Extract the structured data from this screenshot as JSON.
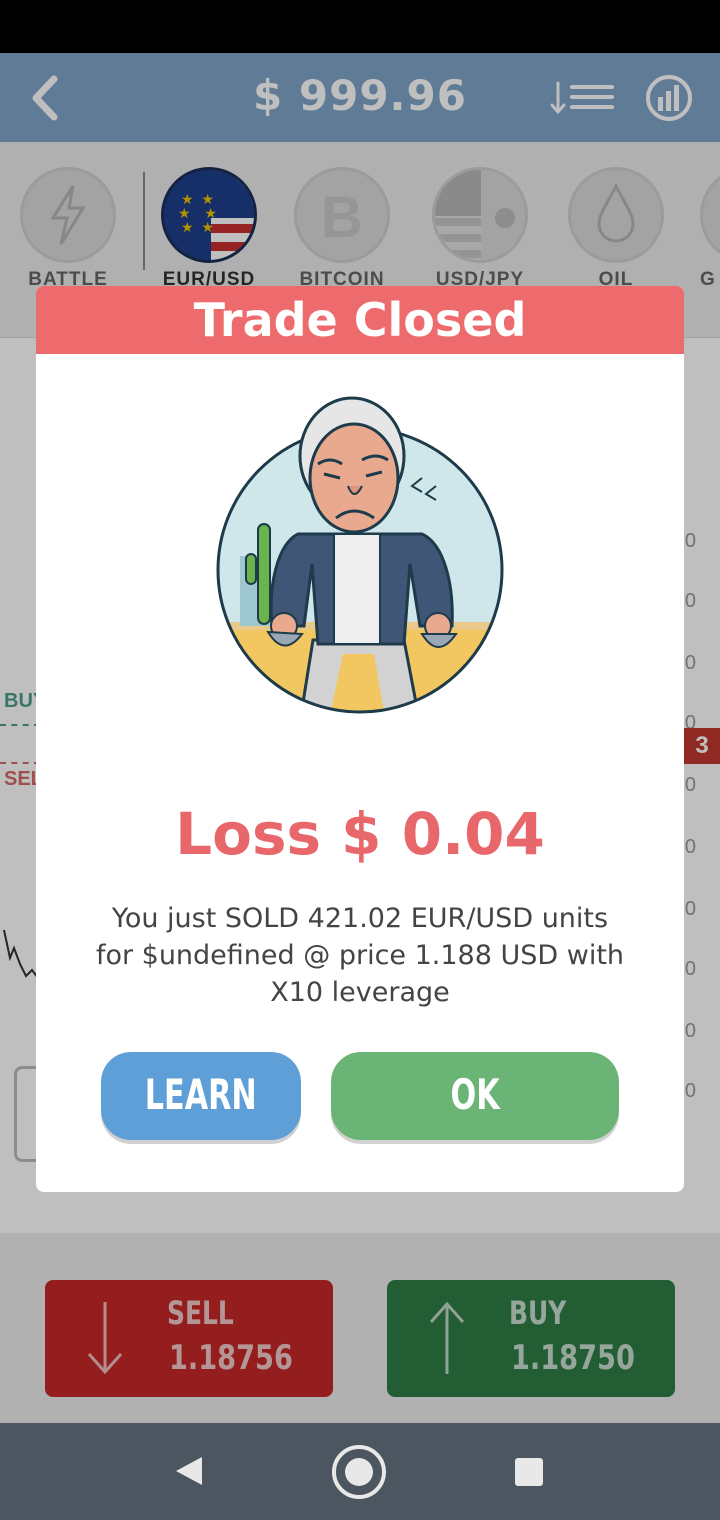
{
  "header": {
    "balance": "$ 999.96"
  },
  "assets": [
    {
      "name": "BATTLE"
    },
    {
      "name": "EUR/USD"
    },
    {
      "name": "BITCOIN"
    },
    {
      "name": "USD/JPY"
    },
    {
      "name": "OIL"
    },
    {
      "name": "G"
    }
  ],
  "chart": {
    "buy_tag": "BUY",
    "sell_tag": "SEL",
    "price_tag": "3",
    "y_ticks": [
      "0",
      "0",
      "0",
      "0",
      "0",
      "0",
      "0",
      "0",
      "0",
      "0"
    ]
  },
  "dialog": {
    "title": "Trade Closed",
    "result": "Loss $ 0.04",
    "message": "You just SOLD 421.02 EUR/USD units for $undefined @ price 1.188 USD with X10 leverage",
    "learn_label": "LEARN",
    "ok_label": "OK"
  },
  "trade": {
    "sell_label": "SELL",
    "sell_price": "1.18756",
    "buy_label": "BUY",
    "buy_price": "1.18750"
  },
  "colors": {
    "header": "#7fa4c9",
    "dialog_header": "#ee6b6d",
    "loss_text": "#e8676a",
    "learn_button": "#5d9fd6",
    "ok_button": "#6ab476",
    "sell_button": "#c62828",
    "buy_button": "#2e7d45"
  },
  "icons": {
    "back": "chevron-left-icon",
    "sort": "sort-list-icon",
    "stats": "stats-chart-icon",
    "nav_back": "triangle-back-icon",
    "nav_home": "circle-home-icon",
    "nav_recent": "square-recents-icon"
  }
}
